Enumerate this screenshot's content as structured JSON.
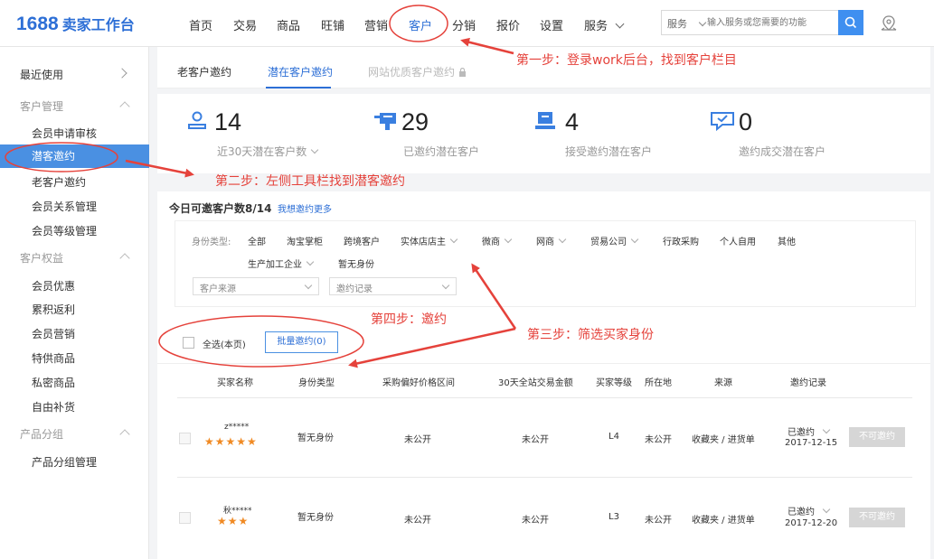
{
  "header": {
    "logo_number": "1688",
    "logo_text": "卖家工作台",
    "nav": [
      "首页",
      "交易",
      "商品",
      "旺铺",
      "营销",
      "客户",
      "分销",
      "报价",
      "设置",
      "服务"
    ],
    "active_nav": "客户",
    "search": {
      "category": "服务",
      "placeholder": "输入服务或您需要的功能"
    },
    "icons": {
      "search": "search-icon",
      "location": "location-pin-icon",
      "more": "chevron-down-icon"
    }
  },
  "sidebar": {
    "recent": "最近使用",
    "groups": [
      {
        "title": "客户管理",
        "items": [
          "会员申请审核",
          "潜客邀约",
          "老客户邀约",
          "会员关系管理",
          "会员等级管理"
        ]
      },
      {
        "title": "客户权益",
        "items": [
          "会员优惠",
          "累积返利",
          "会员营销",
          "特供商品",
          "私密商品",
          "自由补货"
        ]
      },
      {
        "title": "产品分组",
        "items": [
          "产品分组管理"
        ]
      }
    ],
    "active_item": "潜客邀约"
  },
  "tabs": [
    "老客户邀约",
    "潜在客户邀约",
    "网站优质客户邀约"
  ],
  "active_tab": "潜在客户邀约",
  "stats": [
    {
      "value": "14",
      "label": "近30天潜在客户数",
      "icon": "user-icon"
    },
    {
      "value": "29",
      "label": "已邀约潜在客户",
      "icon": "mailbox-icon"
    },
    {
      "value": "4",
      "label": "接受邀约潜在客户",
      "icon": "accept-icon"
    },
    {
      "value": "0",
      "label": "邀约成交潜在客户",
      "icon": "chat-check-icon"
    }
  ],
  "quota": {
    "text": "今日可邀客户数8/14",
    "link": "我想邀约更多"
  },
  "filter": {
    "label": "身份类型:",
    "options": [
      "全部",
      "淘宝掌柜",
      "跨境客户",
      "实体店店主",
      "微商",
      "网商",
      "贸易公司",
      "行政采购",
      "个人自用",
      "其他",
      "生产加工企业",
      "暂无身份"
    ],
    "source_dropdown": "客户来源",
    "record_dropdown": "邀约记录"
  },
  "select_all": "全选(本页)",
  "batch_button": "批量邀约(0)",
  "table": {
    "headers": [
      "买家名称",
      "身份类型",
      "采购偏好价格区间",
      "30天全站交易金额",
      "买家等级",
      "所在地",
      "来源",
      "邀约记录"
    ],
    "rows": [
      {
        "name": "z*****",
        "stars": "★★★★★",
        "type": "暂无身份",
        "price": "未公开",
        "amount": "未公开",
        "level": "L4",
        "location": "未公开",
        "source": "收藏夹 / 进货单",
        "record": "已邀约",
        "date": "2017-12-15",
        "action": "不可邀约"
      },
      {
        "name": "秋*****",
        "stars": "★★★",
        "type": "暂无身份",
        "price": "未公开",
        "amount": "未公开",
        "level": "L3",
        "location": "未公开",
        "source": "收藏夹 / 进货单",
        "record": "已邀约",
        "date": "2017-12-20",
        "action": "不可邀约"
      }
    ]
  },
  "annotations": {
    "step1": "第一步：登录work后台，找到客户栏目",
    "step2": "第二步：左侧工具栏找到潜客邀约",
    "step3": "第三步：筛选买家身份",
    "step4": "第四步：邀约"
  },
  "colors": {
    "brand": "#2d6fd6",
    "active_bg": "#4a90e2",
    "annotation": "#e5423b",
    "star": "#f08a24"
  }
}
